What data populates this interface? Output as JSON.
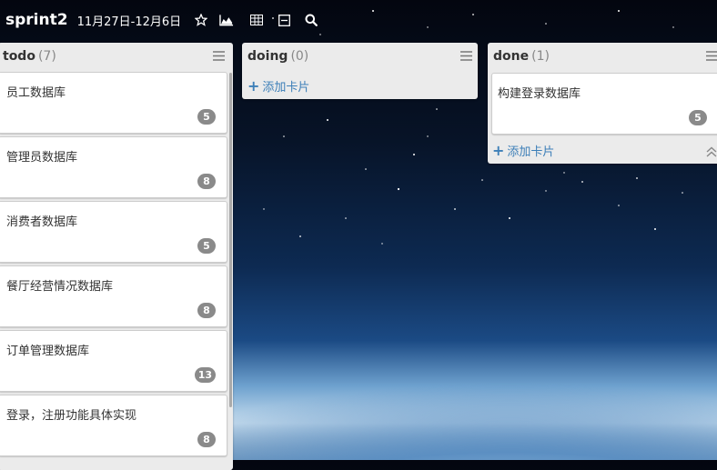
{
  "header": {
    "board_title": "sprint2",
    "date_range": "11月27日-12月6日",
    "icons": [
      "star-icon",
      "chart-icon",
      "table-icon",
      "collapse-icon",
      "search-icon"
    ]
  },
  "lists": {
    "todo": {
      "name": "todo",
      "count": "(7)",
      "cards": [
        {
          "title": "员工数据库",
          "points": "5"
        },
        {
          "title": "管理员数据库",
          "points": "8"
        },
        {
          "title": "消费者数据库",
          "points": "5"
        },
        {
          "title": "餐厅经营情况数据库",
          "points": "8"
        },
        {
          "title": "订单管理数据库",
          "points": "13"
        },
        {
          "title": "登录，注册功能具体实现",
          "points": "8"
        }
      ]
    },
    "doing": {
      "name": "doing",
      "count": "(0)",
      "add_card": "添加卡片"
    },
    "done": {
      "name": "done",
      "count": "(1)",
      "cards": [
        {
          "title": "构建登录数据库",
          "points": "5"
        }
      ],
      "add_card": "添加卡片"
    }
  },
  "colors": {
    "list_bg": "#ebebeb",
    "badge_bg": "#8a8a8a",
    "add_link": "#3d7fb8"
  }
}
